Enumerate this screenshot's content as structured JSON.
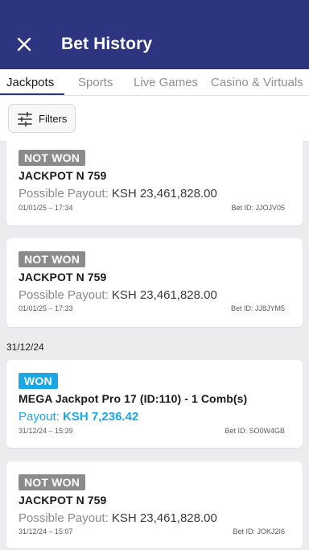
{
  "header": {
    "title": "Bet History",
    "close_icon": "close-icon",
    "bg": "#2e3580"
  },
  "tabs": [
    {
      "label": "Jackpots",
      "active": true
    },
    {
      "label": "Sports",
      "active": false
    },
    {
      "label": "Live Games",
      "active": false
    },
    {
      "label": "Casino & Virtuals",
      "active": false
    }
  ],
  "filters": {
    "label": "Filters",
    "icon": "sliders-icon"
  },
  "date_group": "31/12/24",
  "bets": [
    {
      "status": "NOT WON",
      "title": "JACKPOT N 759",
      "payout_label": "Possible Payout:",
      "payout_value": "KSH 23,461,828.00",
      "datetime": "01/01/25 – 17:34",
      "bet_id_label": "Bet ID:",
      "bet_id": "JJOJV05"
    },
    {
      "status": "NOT WON",
      "title": "JACKPOT N 759",
      "payout_label": "Possible Payout:",
      "payout_value": "KSH 23,461,828.00",
      "datetime": "01/01/25 – 17:33",
      "bet_id_label": "Bet ID:",
      "bet_id": "JJ8JYM5"
    },
    {
      "status": "WON",
      "title": "MEGA Jackpot Pro 17 (ID:110) - 1 Comb(s)",
      "payout_label": "Payout:",
      "payout_value": "KSH 7,236.42",
      "datetime": "31/12/24 – 15:39",
      "bet_id_label": "Bet ID:",
      "bet_id": "SO0W4GB"
    },
    {
      "status": "NOT WON",
      "title": "JACKPOT N 759",
      "payout_label": "Possible Payout:",
      "payout_value": "KSH 23,461,828.00",
      "datetime": "31/12/24 – 15:07",
      "bet_id_label": "Bet ID:",
      "bet_id": "JOKJ2I6"
    }
  ],
  "colors": {
    "won_badge": "#1aa7e6",
    "lost_badge": "#8b8b8b",
    "background": "#ececef"
  }
}
